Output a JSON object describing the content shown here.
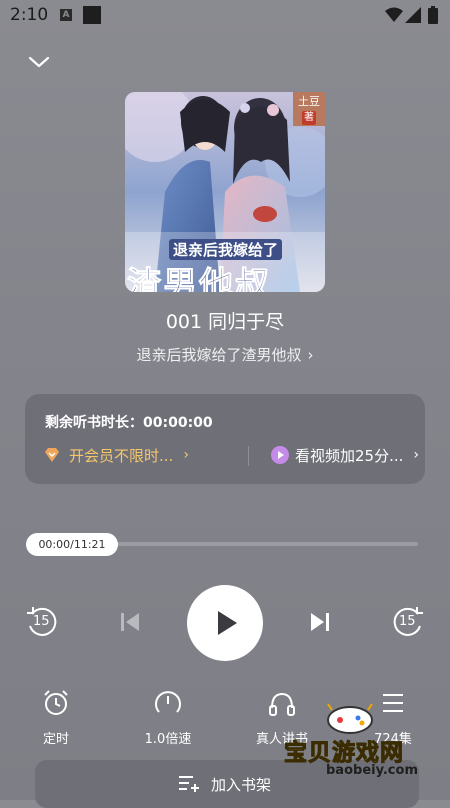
{
  "status_bar": {
    "time": "2:10",
    "icon_a": "A"
  },
  "player": {
    "collapse_icon": "chevron-down-icon",
    "cover": {
      "title_text": "退亲后我嫁给了",
      "big_text": "渣男他叔",
      "author_tag": "土豆",
      "author_badge": "著"
    },
    "track_title": "001 同归于尽",
    "book_title": "退亲后我嫁给了渣男他叔",
    "book_chevron": "›"
  },
  "timer_card": {
    "remaining_label": "剩余听书时长：00:00:00",
    "vip_label": "开会员不限时...",
    "video_label": "看视频加25分...",
    "arrow": "›"
  },
  "progress": {
    "time_label": "00:00/11:21",
    "fraction": 0.0
  },
  "controls": {
    "rewind_label": "15",
    "forward_label": "15"
  },
  "bottom_bar": {
    "timer_label": "定时",
    "speed_label": "1.0倍速",
    "voice_label": "真人讲书",
    "episodes_label": "724集"
  },
  "bookshelf_label": "加入书架",
  "watermark": {
    "text": "宝贝游戏网",
    "sub": "baobeiy.com"
  },
  "colors": {
    "background": "#86878e",
    "card": "#6e6f77",
    "vip": "#f5c76d",
    "video_icon": "#c48be8"
  }
}
